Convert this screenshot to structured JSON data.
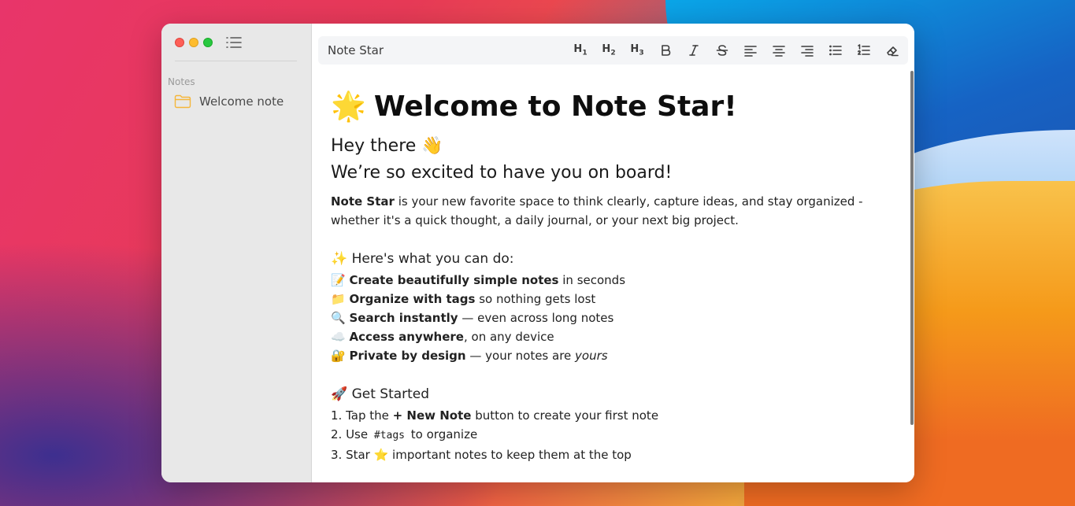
{
  "window": {
    "title": "Note Star"
  },
  "sidebar": {
    "section_label": "Notes",
    "items": [
      {
        "label": "Welcome note",
        "icon": "folder-icon"
      }
    ]
  },
  "toolbar": {
    "title": "Note Star",
    "buttons": [
      {
        "name": "heading-1-button",
        "label": "H",
        "sub": "1"
      },
      {
        "name": "heading-2-button",
        "label": "H",
        "sub": "2"
      },
      {
        "name": "heading-3-button",
        "label": "H",
        "sub": "3"
      },
      {
        "name": "bold-button",
        "icon": "bold-icon"
      },
      {
        "name": "italic-button",
        "icon": "italic-icon"
      },
      {
        "name": "strikethrough-button",
        "icon": "strikethrough-icon"
      },
      {
        "name": "align-left-button",
        "icon": "align-left-icon"
      },
      {
        "name": "align-center-button",
        "icon": "align-center-icon"
      },
      {
        "name": "align-right-button",
        "icon": "align-right-icon"
      },
      {
        "name": "bullet-list-button",
        "icon": "bullet-list-icon"
      },
      {
        "name": "numbered-list-button",
        "icon": "numbered-list-icon"
      },
      {
        "name": "clear-format-button",
        "icon": "eraser-icon"
      }
    ]
  },
  "editor": {
    "title_emoji": "🌟",
    "title": "Welcome to Note Star!",
    "greeting": "Hey there 👋",
    "subtitle": "We’re so excited to have you on board!",
    "intro_bold": "Note Star",
    "intro_rest": " is your new favorite space to think clearly, capture ideas, and stay organized - whether it's a quick thought, a daily journal, or your next big project.",
    "features_heading": "✨ Here's what you can do:",
    "features": [
      {
        "emoji": "📝",
        "bold": "Create beautifully simple notes",
        "rest": " in seconds"
      },
      {
        "emoji": "📁",
        "bold": "Organize with tags",
        "rest": " so nothing gets lost"
      },
      {
        "emoji": "🔍",
        "bold": "Search instantly",
        "rest": " — even across long notes"
      },
      {
        "emoji": "☁️",
        "bold": "Access anywhere",
        "rest": ", on any device"
      },
      {
        "emoji": "🔐",
        "bold": "Private by design",
        "rest": " — your notes are ",
        "italic": "yours"
      }
    ],
    "start_heading": "🚀 Get Started",
    "steps": [
      {
        "prefix": "1. Tap the ",
        "bold": "+ New Note",
        "rest": " button to create your first note"
      },
      {
        "prefix": "2. Use ",
        "code": "#tags",
        "rest": " to organize"
      },
      {
        "prefix": "3. Star ⭐ important notes to keep them at the top"
      }
    ]
  },
  "colors": {
    "accent_folder": "#f5b63a",
    "traffic_red": "#fe5f57",
    "traffic_yellow": "#febc2e",
    "traffic_green": "#28c840"
  }
}
